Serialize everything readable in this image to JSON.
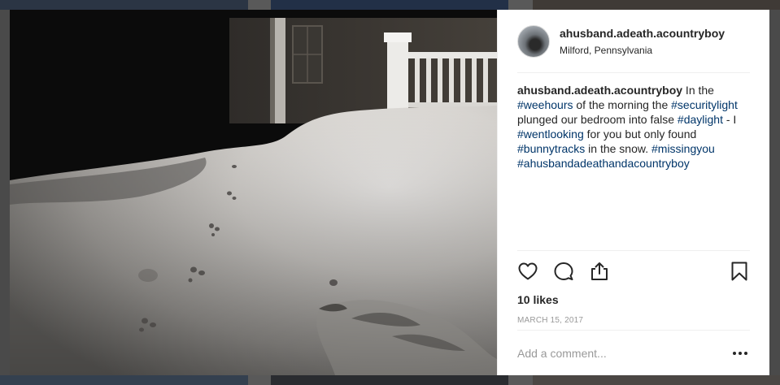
{
  "post": {
    "username": "ahusband.adeath.acountryboy",
    "location": "Milford, Pennsylvania",
    "caption": {
      "user": "ahusband.adeath.acountryboy",
      "seg1": " In the ",
      "tag1": "#weehours",
      "seg2": " of the morning the ",
      "tag2": "#securitylight",
      "seg3": " plunged our bedroom into false ",
      "tag3": "#daylight",
      "seg4": " - I ",
      "tag4": "#wentlooking",
      "seg5": " for you but only found ",
      "tag5": "#bunnytracks",
      "seg6": " in the snow. ",
      "tag6": "#missingyou",
      "seg7": " ",
      "tag7": "#ahusbandadeathandacountryboy"
    },
    "likes": "10 likes",
    "date": "MARCH 15, 2017",
    "comment_placeholder": "Add a comment...",
    "more_label": "•••"
  },
  "icons": {
    "like": "heart-icon",
    "comment": "speech-bubble-icon",
    "share": "share-icon",
    "save": "bookmark-icon",
    "more": "more-options-icon"
  },
  "colors": {
    "hashtag": "#003569",
    "text": "#262626",
    "muted": "#999999",
    "divider": "#efefef"
  }
}
